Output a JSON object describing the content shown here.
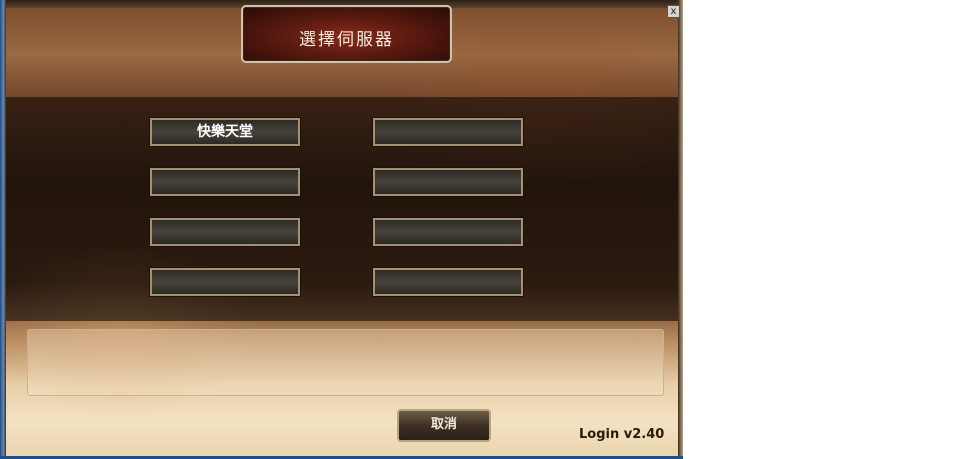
{
  "window": {
    "title": "選擇伺服器",
    "close_label": "x"
  },
  "servers": [
    {
      "label": "快樂天堂"
    },
    {
      "label": ""
    },
    {
      "label": ""
    },
    {
      "label": ""
    },
    {
      "label": ""
    },
    {
      "label": ""
    },
    {
      "label": ""
    },
    {
      "label": ""
    }
  ],
  "message": {
    "text": ""
  },
  "buttons": {
    "cancel_label": "取消"
  },
  "footer": {
    "version": "Login v2.40"
  }
}
